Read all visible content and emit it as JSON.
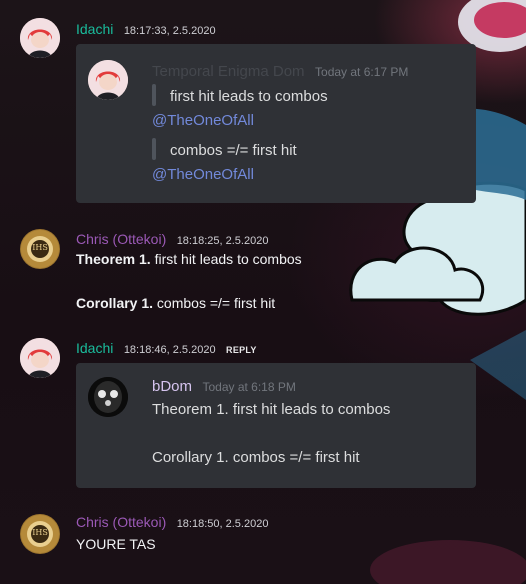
{
  "messages": [
    {
      "user": "Idachi",
      "user_color": "#1abc9c",
      "timestamp": "18:17:33, 2.5.2020",
      "embed": {
        "author": "Temporal Enigma Dom",
        "author_color": "#44474d",
        "time": "Today at 6:17 PM",
        "quote1": "first hit leads to combos",
        "mention1": "@TheOneOfAll",
        "quote2": "combos =/= first hit",
        "mention2": "@TheOneOfAll"
      }
    },
    {
      "user": "Chris (Ottekoi)",
      "user_color": "#9b59b6",
      "timestamp": "18:18:25, 2.5.2020",
      "line1_bold": "Theorem 1.",
      "line1_text": " first hit leads to combos",
      "line2_bold": "Corollary 1.",
      "line2_text": " combos =/= first hit"
    },
    {
      "user": "Idachi",
      "user_color": "#1abc9c",
      "timestamp": "18:18:46, 2.5.2020",
      "reply_label": "REPLY",
      "embed": {
        "author": "bDom",
        "author_color": "#d6c4ef",
        "time": "Today at 6:18 PM",
        "line1": "Theorem 1. first hit leads to combos",
        "line2": "Corollary 1. combos =/= first hit"
      }
    },
    {
      "user": "Chris (Ottekoi)",
      "user_color": "#9b59b6",
      "timestamp": "18:18:50, 2.5.2020",
      "text": "YOURE TAS"
    }
  ],
  "avatar_text": {
    "chris": "IHS"
  }
}
